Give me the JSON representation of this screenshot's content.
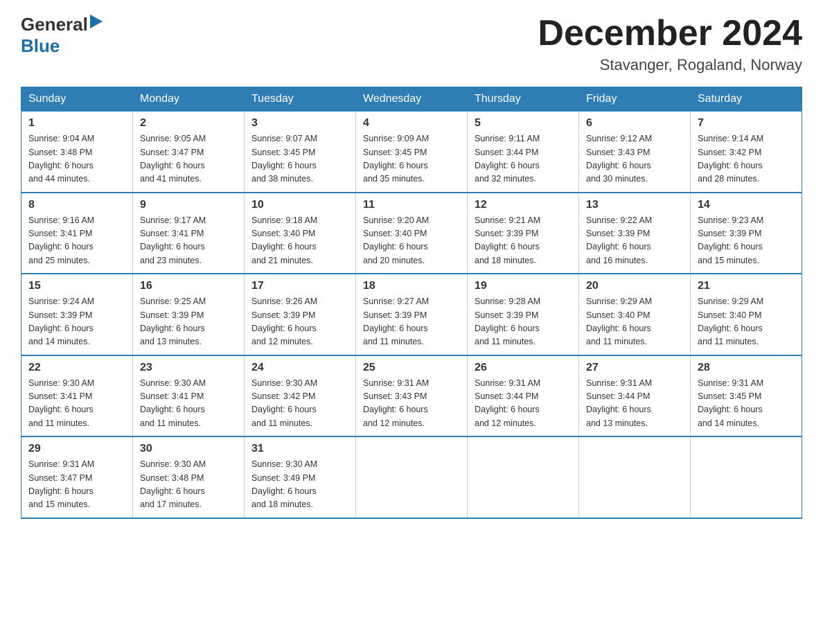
{
  "header": {
    "logo_general": "General",
    "logo_blue": "Blue",
    "month_title": "December 2024",
    "location": "Stavanger, Rogaland, Norway"
  },
  "days_of_week": [
    "Sunday",
    "Monday",
    "Tuesday",
    "Wednesday",
    "Thursday",
    "Friday",
    "Saturday"
  ],
  "weeks": [
    [
      {
        "num": "1",
        "sunrise": "9:04 AM",
        "sunset": "3:48 PM",
        "daylight": "6 hours and 44 minutes."
      },
      {
        "num": "2",
        "sunrise": "9:05 AM",
        "sunset": "3:47 PM",
        "daylight": "6 hours and 41 minutes."
      },
      {
        "num": "3",
        "sunrise": "9:07 AM",
        "sunset": "3:45 PM",
        "daylight": "6 hours and 38 minutes."
      },
      {
        "num": "4",
        "sunrise": "9:09 AM",
        "sunset": "3:45 PM",
        "daylight": "6 hours and 35 minutes."
      },
      {
        "num": "5",
        "sunrise": "9:11 AM",
        "sunset": "3:44 PM",
        "daylight": "6 hours and 32 minutes."
      },
      {
        "num": "6",
        "sunrise": "9:12 AM",
        "sunset": "3:43 PM",
        "daylight": "6 hours and 30 minutes."
      },
      {
        "num": "7",
        "sunrise": "9:14 AM",
        "sunset": "3:42 PM",
        "daylight": "6 hours and 28 minutes."
      }
    ],
    [
      {
        "num": "8",
        "sunrise": "9:16 AM",
        "sunset": "3:41 PM",
        "daylight": "6 hours and 25 minutes."
      },
      {
        "num": "9",
        "sunrise": "9:17 AM",
        "sunset": "3:41 PM",
        "daylight": "6 hours and 23 minutes."
      },
      {
        "num": "10",
        "sunrise": "9:18 AM",
        "sunset": "3:40 PM",
        "daylight": "6 hours and 21 minutes."
      },
      {
        "num": "11",
        "sunrise": "9:20 AM",
        "sunset": "3:40 PM",
        "daylight": "6 hours and 20 minutes."
      },
      {
        "num": "12",
        "sunrise": "9:21 AM",
        "sunset": "3:39 PM",
        "daylight": "6 hours and 18 minutes."
      },
      {
        "num": "13",
        "sunrise": "9:22 AM",
        "sunset": "3:39 PM",
        "daylight": "6 hours and 16 minutes."
      },
      {
        "num": "14",
        "sunrise": "9:23 AM",
        "sunset": "3:39 PM",
        "daylight": "6 hours and 15 minutes."
      }
    ],
    [
      {
        "num": "15",
        "sunrise": "9:24 AM",
        "sunset": "3:39 PM",
        "daylight": "6 hours and 14 minutes."
      },
      {
        "num": "16",
        "sunrise": "9:25 AM",
        "sunset": "3:39 PM",
        "daylight": "6 hours and 13 minutes."
      },
      {
        "num": "17",
        "sunrise": "9:26 AM",
        "sunset": "3:39 PM",
        "daylight": "6 hours and 12 minutes."
      },
      {
        "num": "18",
        "sunrise": "9:27 AM",
        "sunset": "3:39 PM",
        "daylight": "6 hours and 11 minutes."
      },
      {
        "num": "19",
        "sunrise": "9:28 AM",
        "sunset": "3:39 PM",
        "daylight": "6 hours and 11 minutes."
      },
      {
        "num": "20",
        "sunrise": "9:29 AM",
        "sunset": "3:40 PM",
        "daylight": "6 hours and 11 minutes."
      },
      {
        "num": "21",
        "sunrise": "9:29 AM",
        "sunset": "3:40 PM",
        "daylight": "6 hours and 11 minutes."
      }
    ],
    [
      {
        "num": "22",
        "sunrise": "9:30 AM",
        "sunset": "3:41 PM",
        "daylight": "6 hours and 11 minutes."
      },
      {
        "num": "23",
        "sunrise": "9:30 AM",
        "sunset": "3:41 PM",
        "daylight": "6 hours and 11 minutes."
      },
      {
        "num": "24",
        "sunrise": "9:30 AM",
        "sunset": "3:42 PM",
        "daylight": "6 hours and 11 minutes."
      },
      {
        "num": "25",
        "sunrise": "9:31 AM",
        "sunset": "3:43 PM",
        "daylight": "6 hours and 12 minutes."
      },
      {
        "num": "26",
        "sunrise": "9:31 AM",
        "sunset": "3:44 PM",
        "daylight": "6 hours and 12 minutes."
      },
      {
        "num": "27",
        "sunrise": "9:31 AM",
        "sunset": "3:44 PM",
        "daylight": "6 hours and 13 minutes."
      },
      {
        "num": "28",
        "sunrise": "9:31 AM",
        "sunset": "3:45 PM",
        "daylight": "6 hours and 14 minutes."
      }
    ],
    [
      {
        "num": "29",
        "sunrise": "9:31 AM",
        "sunset": "3:47 PM",
        "daylight": "6 hours and 15 minutes."
      },
      {
        "num": "30",
        "sunrise": "9:30 AM",
        "sunset": "3:48 PM",
        "daylight": "6 hours and 17 minutes."
      },
      {
        "num": "31",
        "sunrise": "9:30 AM",
        "sunset": "3:49 PM",
        "daylight": "6 hours and 18 minutes."
      },
      null,
      null,
      null,
      null
    ]
  ],
  "labels": {
    "sunrise": "Sunrise:",
    "sunset": "Sunset:",
    "daylight": "Daylight:"
  }
}
